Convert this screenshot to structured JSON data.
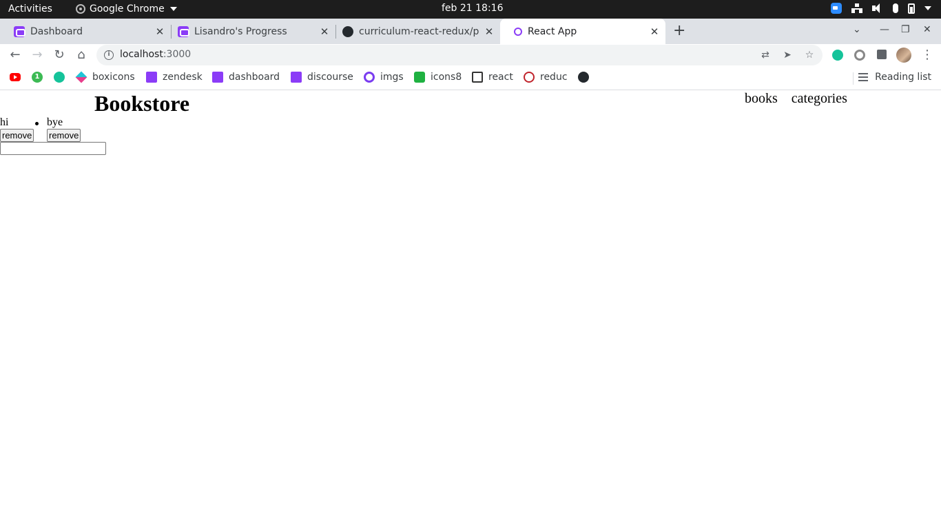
{
  "system_bar": {
    "activities": "Activities",
    "app_name": "Google Chrome",
    "clock": "feb 21  18:16"
  },
  "tabs": [
    {
      "title": "Dashboard",
      "favicon": "microverse-icon"
    },
    {
      "title": "Lisandro's Progress",
      "favicon": "microverse-icon"
    },
    {
      "title": "curriculum-react-redux/p",
      "favicon": "github-icon"
    },
    {
      "title": "React App",
      "favicon": "react-icon",
      "active": true
    }
  ],
  "toolbar": {
    "url_host": "localhost",
    "url_port": ":3000"
  },
  "bookmarks": [
    {
      "label": "",
      "icon": "youtube-icon"
    },
    {
      "label": "",
      "icon": "green-1-icon"
    },
    {
      "label": "",
      "icon": "grammarly-icon"
    },
    {
      "label": "boxicons",
      "icon": "boxicons-icon"
    },
    {
      "label": "zendesk",
      "icon": "microverse-icon"
    },
    {
      "label": "dashboard",
      "icon": "microverse-icon"
    },
    {
      "label": "discourse",
      "icon": "microverse-icon"
    },
    {
      "label": "imgs",
      "icon": "q-icon"
    },
    {
      "label": "icons8",
      "icon": "icons8-icon"
    },
    {
      "label": "react",
      "icon": "terminal-icon"
    },
    {
      "label": "reduc",
      "icon": "redux-icon"
    },
    {
      "label": "",
      "icon": "github-icon"
    }
  ],
  "reading_list": "Reading list",
  "app": {
    "title": "Bookstore",
    "nav": {
      "books": "books",
      "categories": "categories"
    },
    "books": [
      {
        "title": "hi",
        "remove_label": "remove"
      },
      {
        "title": "bye",
        "remove_label": "remove"
      }
    ],
    "input": {
      "value": "",
      "placeholder": ""
    }
  }
}
